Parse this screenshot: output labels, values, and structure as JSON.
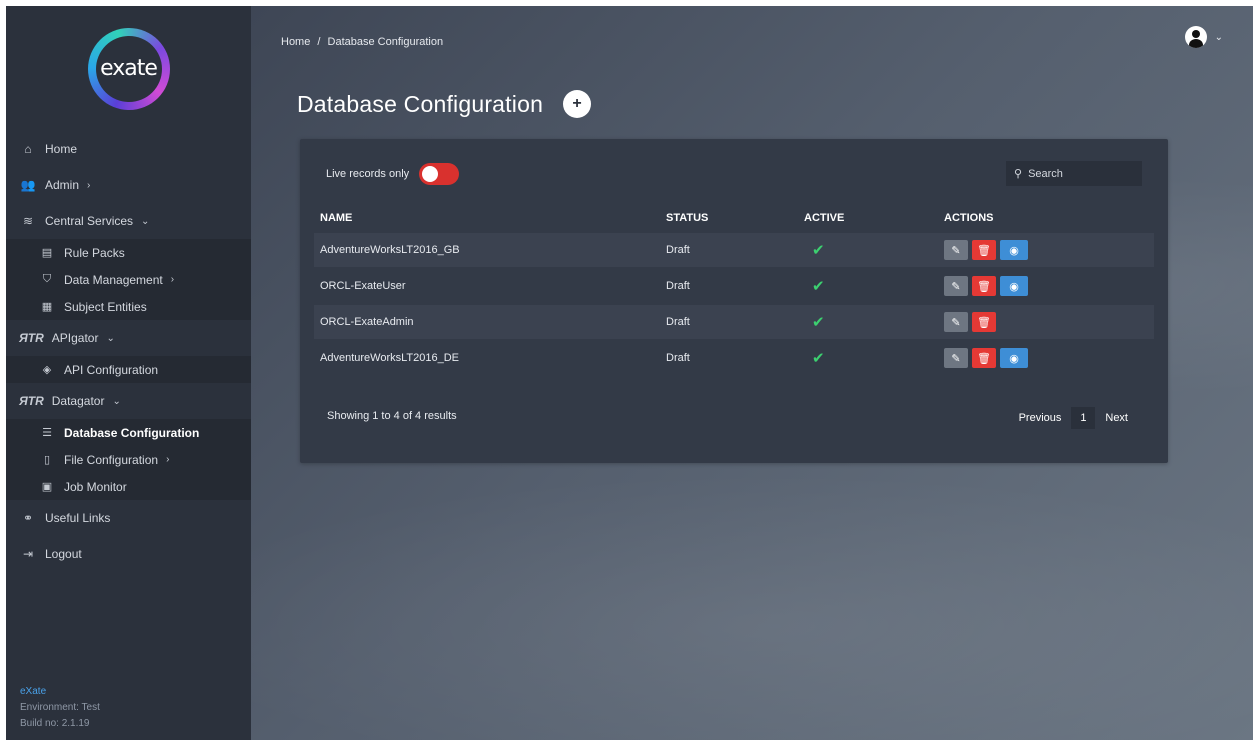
{
  "logo": {
    "text": "exate"
  },
  "sidebar": {
    "home": {
      "label": "Home",
      "icon": "home-icon"
    },
    "admin": {
      "label": "Admin",
      "icon": "users-icon"
    },
    "central": {
      "label": "Central Services",
      "icon": "layers-icon"
    },
    "central_items": [
      {
        "label": "Rule Packs",
        "icon": "list-icon"
      },
      {
        "label": "Data Management",
        "icon": "shield-icon"
      },
      {
        "label": "Subject Entities",
        "icon": "document-icon"
      }
    ],
    "apigator": {
      "label": "APIgator",
      "mark": "ЯTR"
    },
    "apigator_items": [
      {
        "label": "API Configuration",
        "icon": "cube-icon"
      }
    ],
    "datagator": {
      "label": "Datagator",
      "mark": "ЯTR"
    },
    "datagator_items": [
      {
        "label": "Database Configuration",
        "icon": "database-icon"
      },
      {
        "label": "File Configuration",
        "icon": "file-icon"
      },
      {
        "label": "Job Monitor",
        "icon": "briefcase-icon"
      }
    ],
    "useful_links": {
      "label": "Useful Links",
      "icon": "link-icon"
    },
    "logout": {
      "label": "Logout",
      "icon": "logout-icon"
    },
    "footer": {
      "brand": "eXate",
      "environment": "Environment: Test",
      "build": "Build no: 2.1.19"
    }
  },
  "breadcrumb": {
    "home": "Home",
    "separator": "/",
    "current": "Database Configuration"
  },
  "page": {
    "title": "Database Configuration",
    "add_label": "+"
  },
  "filters": {
    "live_label": "Live records only",
    "live_on": false,
    "search_placeholder": "Search"
  },
  "table": {
    "headers": {
      "name": "NAME",
      "status": "STATUS",
      "active": "ACTIVE",
      "actions": "ACTIONS"
    },
    "rows": [
      {
        "name": "AdventureWorksLT2016_GB",
        "status": "Draft",
        "active": true,
        "view": true
      },
      {
        "name": "ORCL-ExateUser",
        "status": "Draft",
        "active": true,
        "view": true
      },
      {
        "name": "ORCL-ExateAdmin",
        "status": "Draft",
        "active": true,
        "view": false
      },
      {
        "name": "AdventureWorksLT2016_DE",
        "status": "Draft",
        "active": true,
        "view": true
      }
    ]
  },
  "pagination": {
    "summary": "Showing 1 to 4 of 4 results",
    "previous": "Previous",
    "page": "1",
    "next": "Next"
  },
  "colors": {
    "toggle_off": "#d9312e",
    "delete": "#e53935",
    "view": "#3e8ed6",
    "check": "#3cd070"
  }
}
